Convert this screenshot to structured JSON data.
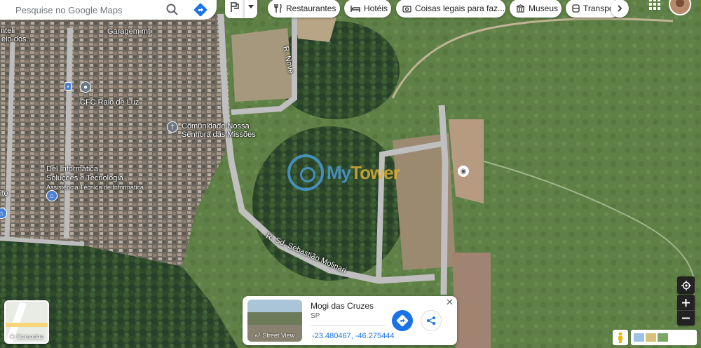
{
  "search": {
    "placeholder": "Pesquise no Google Maps"
  },
  "chips": [
    {
      "label": "Restaurantes",
      "icon": "fork-knife-icon"
    },
    {
      "label": "Hotéis",
      "icon": "bed-icon"
    },
    {
      "label": "Coisas legais para faz...",
      "icon": "camera-icon"
    },
    {
      "label": "Museus",
      "icon": "museum-icon"
    },
    {
      "label": "Transpo",
      "icon": "bus-icon"
    }
  ],
  "map_labels": {
    "garagem": "Garagem mt",
    "cfc": "CFC Raio de Luz",
    "comunidade_line1": "Comunidade Nossa",
    "comunidade_line2": "Senhora das Missões",
    "del_line1": "Del Informática",
    "del_line2": "Soluções e Tecnologia",
    "del_line3": "Assistência Técnica de Informática",
    "edge_top_left_1": "Inteli",
    "edge_top_left_2": "eio dos...",
    "edge_left": "ite",
    "street_nove": "R. Nove",
    "street_sebastiao": "R. Sd. Sebastião Molinari"
  },
  "watermark": {
    "part1": "My",
    "part2": "Tower"
  },
  "layers": {
    "label": "Camadas"
  },
  "card": {
    "title": "Mogi das Cruzes",
    "subtitle": "SP",
    "coords": "-23.480467, -46.275444",
    "streetview_label": "Street View"
  },
  "colors": {
    "accent": "#1a73e8",
    "watermark_blue": "#4a9fe0",
    "watermark_gold": "#e0b13a"
  }
}
